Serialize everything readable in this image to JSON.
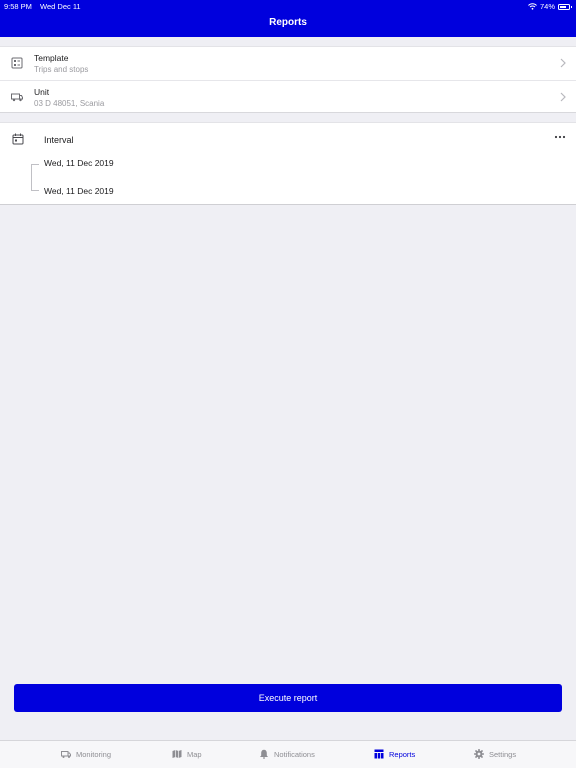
{
  "status_bar": {
    "time": "9:58 PM",
    "date": "Wed Dec 11",
    "battery": "74%"
  },
  "header": {
    "title": "Reports"
  },
  "rows": [
    {
      "title": "Template",
      "subtitle": "Trips and stops",
      "icon": "template-icon"
    },
    {
      "title": "Unit",
      "subtitle": "03 D 48051, Scania",
      "icon": "truck-icon"
    }
  ],
  "interval": {
    "title": "Interval",
    "from": "Wed, 11 Dec 2019",
    "to": "Wed, 11 Dec 2019"
  },
  "execute_label": "Execute report",
  "tabs": [
    {
      "label": "Monitoring",
      "icon": "monitoring-truck-icon"
    },
    {
      "label": "Map",
      "icon": "map-icon"
    },
    {
      "label": "Notifications",
      "icon": "bell-icon"
    },
    {
      "label": "Reports",
      "icon": "reports-icon",
      "active": true
    },
    {
      "label": "Settings",
      "icon": "gear-icon"
    }
  ],
  "colors": {
    "accent": "#0000dd",
    "background": "#efeff4",
    "secondary_text": "#9a9a9f",
    "inactive_tab": "#8e8e93"
  }
}
